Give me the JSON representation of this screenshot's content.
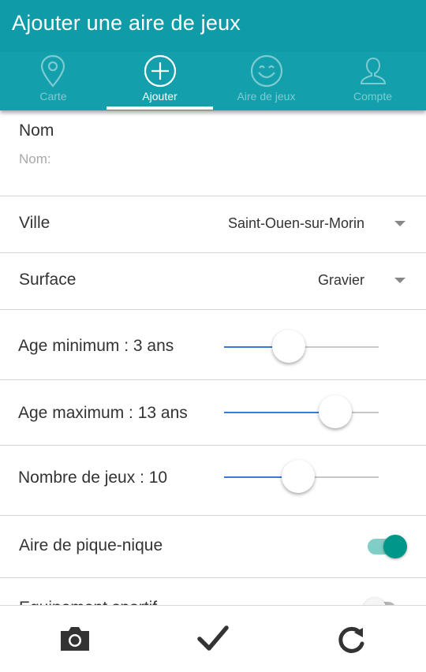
{
  "app": {
    "title": "Ajouter une aire de jeux"
  },
  "tabs": [
    {
      "label": "Carte",
      "icon": "map-pin-icon",
      "active": false
    },
    {
      "label": "Ajouter",
      "icon": "add-circle-icon",
      "active": true
    },
    {
      "label": "Aire de jeux",
      "icon": "smiley-icon",
      "active": false
    },
    {
      "label": "Compte",
      "icon": "user-icon",
      "active": false
    }
  ],
  "form": {
    "name": {
      "label": "Nom",
      "placeholder": "Nom:",
      "value": ""
    },
    "city": {
      "label": "Ville",
      "value": "Saint-Ouen-sur-Morin"
    },
    "surface": {
      "label": "Surface",
      "value": "Gravier"
    },
    "age_min": {
      "label": "Age minimum : 3 ans",
      "level": 0.42
    },
    "age_max": {
      "label": "Age maximum : 13 ans",
      "level": 0.72
    },
    "game_count": {
      "label": "Nombre de jeux : 10",
      "level": 0.48
    },
    "picnic": {
      "label": "Aire de pique-nique",
      "on": true
    },
    "sport": {
      "label": "Equipement sportif",
      "on": false
    }
  },
  "bottom_bar": {
    "camera": "camera-icon",
    "confirm": "checkmark-icon",
    "reset": "refresh-icon"
  },
  "colors": {
    "header": "#0f9ba7",
    "accent": "#3b79d6",
    "toggle_on": "#00978a"
  }
}
